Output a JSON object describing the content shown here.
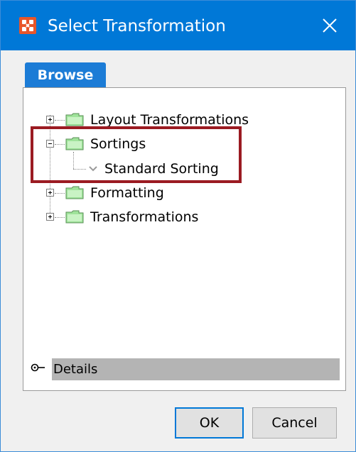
{
  "window": {
    "title": "Select Transformation",
    "app_icon": "transform-app-icon",
    "close_icon": "close-icon"
  },
  "tabs": [
    {
      "label": "Browse",
      "active": true
    }
  ],
  "tree": [
    {
      "label": "Layout Transformations",
      "expanded": false,
      "icon": "folder-icon"
    },
    {
      "label": "Sortings",
      "expanded": true,
      "icon": "folder-icon",
      "children": [
        {
          "label": "Standard Sorting",
          "icon": "chevron-down-icon"
        }
      ]
    },
    {
      "label": "Formatting",
      "expanded": false,
      "icon": "folder-icon"
    },
    {
      "label": "Transformations",
      "expanded": false,
      "icon": "folder-icon"
    }
  ],
  "details": {
    "label": "Details"
  },
  "buttons": {
    "ok": "OK",
    "cancel": "Cancel"
  },
  "colors": {
    "titlebar": "#0078d7",
    "tab": "#1c7cd6",
    "highlight_border": "#9b1b22",
    "folder_fill": "#9fe39a"
  }
}
